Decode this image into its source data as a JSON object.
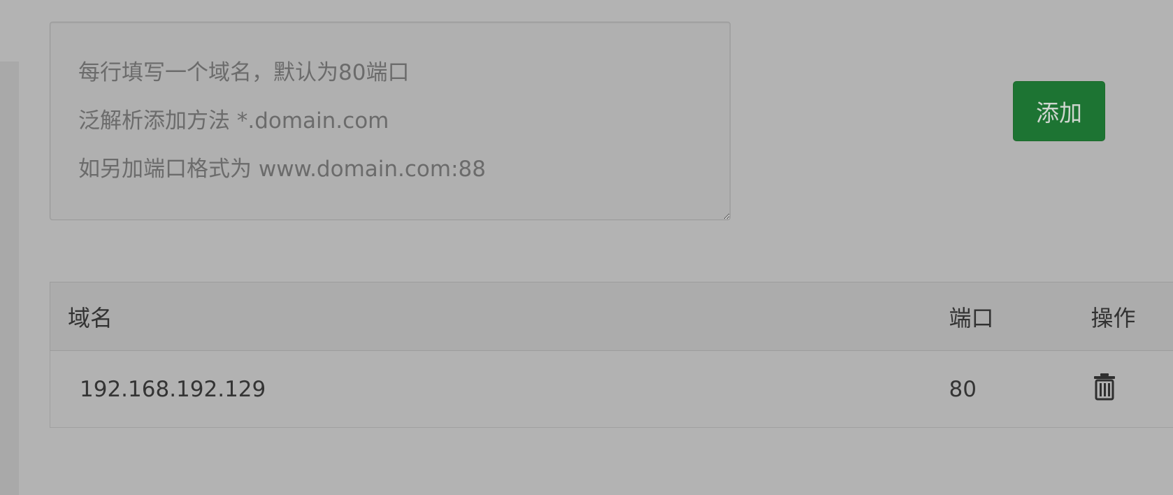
{
  "form": {
    "textarea_placeholder": "每行填写一个域名，默认为80端口\n泛解析添加方法 *.domain.com\n如另加端口格式为 www.domain.com:88",
    "textarea_value": "",
    "add_button_label": "添加"
  },
  "table": {
    "columns": [
      "域名",
      "端口",
      "操作"
    ],
    "rows": [
      {
        "domain": "192.168.192.129",
        "port": "80",
        "action_icon": "trash-icon"
      }
    ]
  },
  "colors": {
    "background": "#b3b3b3",
    "button": "#1d7433",
    "button_text": "#cfd6cf"
  }
}
